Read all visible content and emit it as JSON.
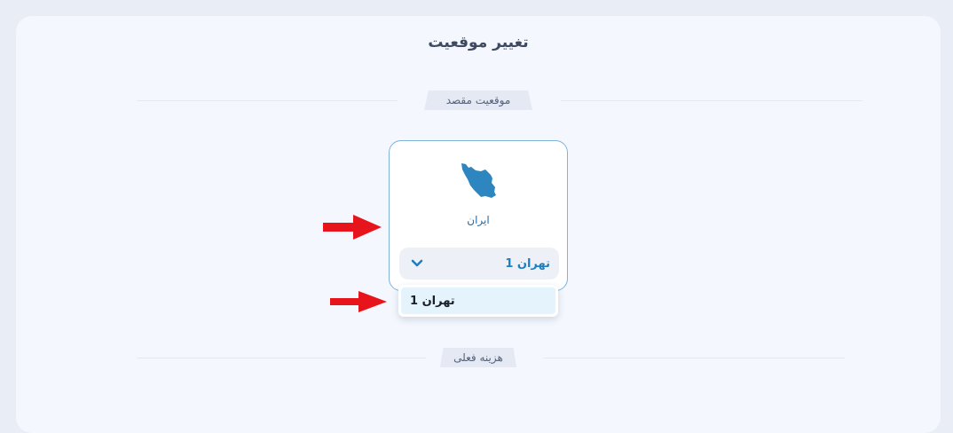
{
  "header": {
    "title": "تغییر موقعیت"
  },
  "destination_section": {
    "label": "موقعیت مقصد"
  },
  "location_card": {
    "country": "ایران",
    "map_icon": "iran-map-icon",
    "selected_location": "تهران 1"
  },
  "dropdown": {
    "options": [
      "تهران 1"
    ]
  },
  "cost_section": {
    "label": "هزینه فعلی"
  },
  "colors": {
    "accent": "#1e7fbf",
    "map": "#2e86c1",
    "annotation_arrow": "#e8141b"
  }
}
